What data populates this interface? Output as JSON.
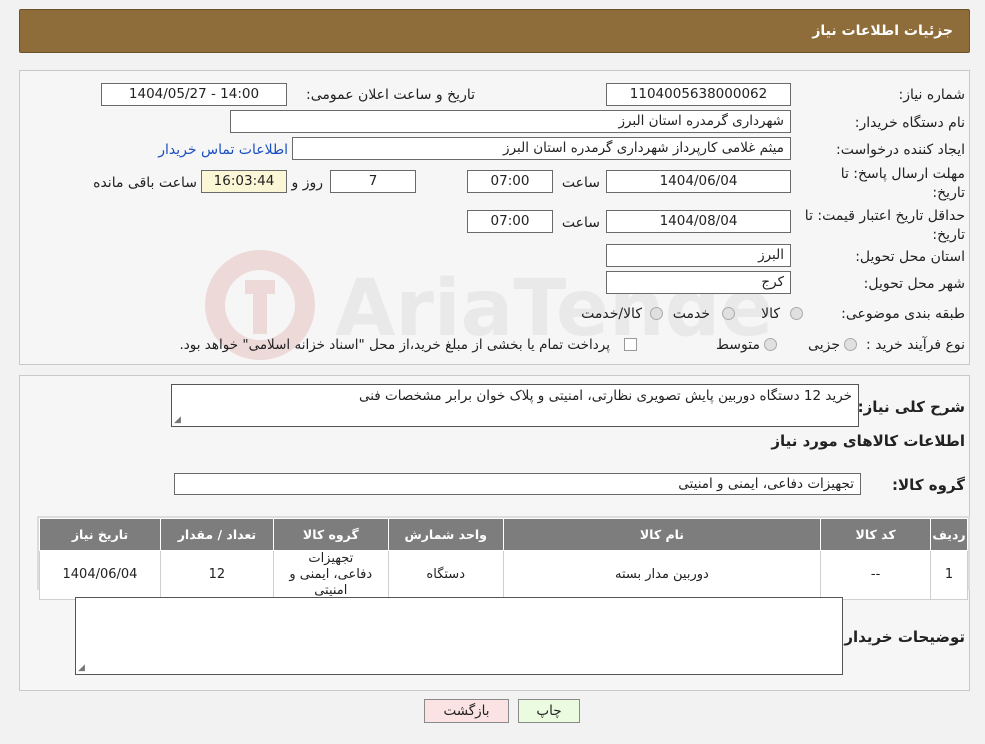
{
  "header": {
    "title": "جزئیات اطلاعات نیاز"
  },
  "form": {
    "need_number_label": "شماره نیاز:",
    "need_number": "1104005638000062",
    "announce_label": "تاریخ و ساعت اعلان عمومی:",
    "announce_value": "1404/05/27 - 14:00",
    "buyer_org_label": "نام دستگاه خریدار:",
    "buyer_org": "شهرداری گرمدره استان البرز",
    "creator_label": "ایجاد کننده درخواست:",
    "creator": "میثم غلامی کارپرداز شهرداری گرمدره استان البرز",
    "contact_link": "اطلاعات تماس خریدار",
    "deadline_label_1": "مهلت ارسال پاسخ: تا",
    "deadline_label_2": "تاریخ:",
    "deadline_date": "1404/06/04",
    "time_label": "ساعت",
    "deadline_time": "07:00",
    "days": "7",
    "days_label": "روز و",
    "remaining": "16:03:44",
    "remaining_label": "ساعت باقی مانده",
    "validity_label_1": "حداقل تاریخ اعتبار قیمت: تا",
    "validity_label_2": "تاریخ:",
    "validity_date": "1404/08/04",
    "validity_time": "07:00",
    "province_label": "استان محل تحویل:",
    "province": "البرز",
    "city_label": "شهر محل تحویل:",
    "city": "کرج",
    "category_label": "طبقه بندی موضوعی:",
    "category_options": [
      "کالا",
      "خدمت",
      "کالا/خدمت"
    ],
    "process_label": "نوع فرآیند خرید :",
    "process_options": [
      "جزیی",
      "متوسط"
    ],
    "process_note": "پرداخت تمام یا بخشی از مبلغ خرید،از محل \"اسناد خزانه اسلامی\" خواهد بود."
  },
  "details": {
    "summary_label": "شرح کلی نیاز:",
    "summary": "خرید 12 دستگاه دوربین پایش تصویری نظارتی، امنیتی و پلاک خوان برابر مشخصات فنی",
    "goods_info_title": "اطلاعات کالاهای مورد نیاز",
    "goods_group_label": "گروه کالا:",
    "goods_group": "تجهیزات دفاعی، ایمنی و امنیتی",
    "table": {
      "headers": [
        "ردیف",
        "کد کالا",
        "نام کالا",
        "واحد شمارش",
        "گروه کالا",
        "تعداد / مقدار",
        "تاریخ نیاز"
      ],
      "rows": [
        [
          "1",
          "--",
          "دوربین مدار بسته",
          "دستگاه",
          "تجهیزات دفاعی، ایمنی و امنیتی",
          "12",
          "1404/06/04"
        ]
      ]
    },
    "buyer_notes_label": "توضیحات خریدار:",
    "buyer_notes": ""
  },
  "buttons": {
    "print": "چاپ",
    "back": "بازگشت"
  },
  "watermark": {
    "text": "AriaTender.neT"
  },
  "colors": {
    "header": "#8e6d3b",
    "print_btn": "#eafbe0",
    "back_btn": "#fbe3e3",
    "table_header": "#7d7d7d"
  }
}
